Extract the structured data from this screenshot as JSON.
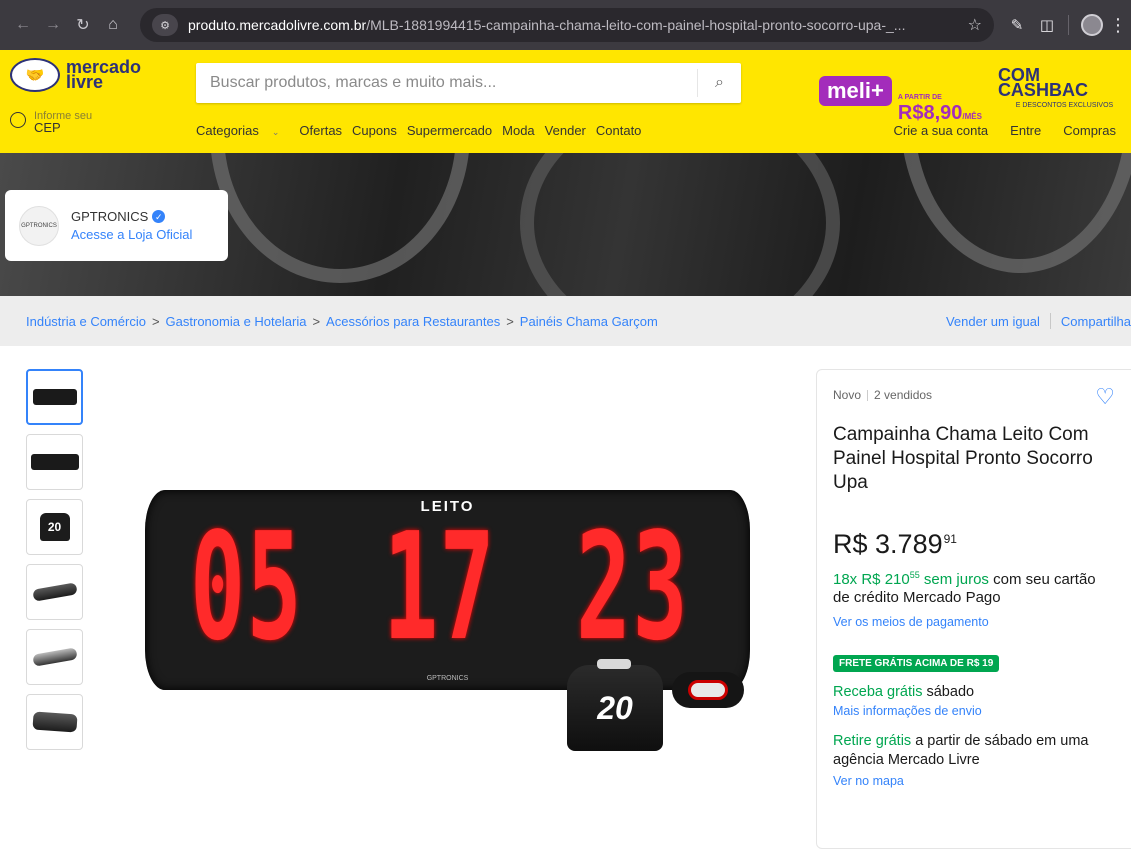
{
  "browser": {
    "url_host": "produto.mercadolivre.com.br",
    "url_path": "/MLB-1881994415-campainha-chama-leito-com-painel-hospital-pronto-socorro-upa-_..."
  },
  "header": {
    "logo_line1": "mercado",
    "logo_line2": "livre",
    "search_placeholder": "Buscar produtos, marcas e muito mais...",
    "promo_meli": "meli+",
    "promo_from": "A PARTIR DE",
    "promo_price": "R$8,90",
    "promo_period": "/MÊS",
    "promo_cash": "COM CASHBAC",
    "promo_cash_sub": "E DESCONTOS EXCLUSIVOS",
    "cep_line1": "Informe seu",
    "cep_line2": "CEP",
    "menu": [
      "Categorias",
      "Ofertas",
      "Cupons",
      "Supermercado",
      "Moda",
      "Vender",
      "Contato"
    ],
    "account": [
      "Crie a sua conta",
      "Entre",
      "Compras"
    ]
  },
  "store": {
    "logo_text": "GPTRONICS",
    "name": "GPTRONICS",
    "link": "Acesse a Loja Oficial"
  },
  "breadcrumb": {
    "items": [
      "Indústria e Comércio",
      "Gastronomia e Hotelaria",
      "Acessórios para Restaurantes",
      "Painéis Chama Garçom"
    ],
    "separator": ">",
    "sell_same": "Vender um igual",
    "share": "Compartilha"
  },
  "gallery": {
    "thumb_count": 6,
    "thumb_box_number": "20",
    "hero_label": "LEITO",
    "hero_digits": [
      "05",
      "17",
      "23"
    ],
    "hero_brand": "GPTRONICS",
    "callbox_number": "20"
  },
  "product": {
    "condition": "Novo",
    "sold": "2 vendidos",
    "title": "Campainha Chama Leito Com Painel Hospital Pronto Socorro Upa",
    "price_currency": "R$",
    "price_int": "3.789",
    "price_cents": "91",
    "installments_prefix": "18x R$ 210",
    "installments_cents": "55",
    "installments_suffix_green": " sem juros",
    "installments_suffix": " com seu cartão de crédito Mercado Pago",
    "payment_link": "Ver os meios de pagamento",
    "shipping_badge": "FRETE GRÁTIS ACIMA DE R$ 19",
    "ship_green": "Receba grátis",
    "ship_day": " sábado",
    "ship_link": "Mais informações de envio",
    "pickup_green": "Retire grátis",
    "pickup_text": " a partir de sábado em uma agência Mercado Livre",
    "map_link": "Ver no mapa"
  }
}
